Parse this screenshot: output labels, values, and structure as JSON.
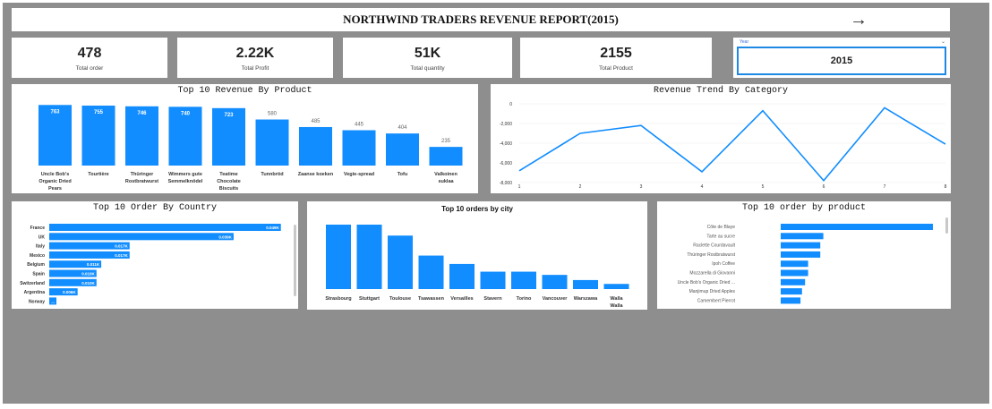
{
  "header": {
    "title": "NORTHWIND TRADERS REVENUE REPORT(2015)",
    "arrow_icon": "arrow-right-icon"
  },
  "kpis": [
    {
      "value": "478",
      "label": "Total order"
    },
    {
      "value": "2.22K",
      "label": "Total Profit"
    },
    {
      "value": "51K",
      "label": "Total quantity"
    },
    {
      "value": "2155",
      "label": "Total Product"
    }
  ],
  "slicer": {
    "label": "Year",
    "value": "2015"
  },
  "colors": {
    "accent": "#118dff",
    "background": "#8e8e8e"
  },
  "chart_data": [
    {
      "type": "bar",
      "title": "Top 10 Revenue By Product",
      "categories": [
        "Uncle Bob's Organic Dried Pears",
        "Tourtière",
        "Thüringer Rostbratwurst",
        "Wimmers gute Semmelknödel",
        "Teatime Chocolate Biscuits",
        "Tunnbröd",
        "Zaanse koeken",
        "Vegie-spread",
        "Tofu",
        "Valkoinen suklaa"
      ],
      "label_lines": [
        [
          "Uncle Bob's",
          "Organic Dried",
          "Pears"
        ],
        [
          "Tourtière"
        ],
        [
          "Thüringer",
          "Rostbratwurst"
        ],
        [
          "Wimmers gute",
          "Semmelknödel"
        ],
        [
          "Teatime",
          "Chocolate",
          "Biscuits"
        ],
        [
          "Tunnbröd"
        ],
        [
          "Zaanse koeken"
        ],
        [
          "Vegie-spread"
        ],
        [
          "Tofu"
        ],
        [
          "Valkoinen",
          "suklaa"
        ]
      ],
      "values": [
        763,
        755,
        746,
        740,
        723,
        580,
        485,
        445,
        404,
        235
      ],
      "ylim": [
        0,
        800
      ]
    },
    {
      "type": "line",
      "title": "Revenue Trend By Category",
      "x": [
        1,
        2,
        3,
        4,
        5,
        6,
        7,
        8
      ],
      "y": [
        -6800,
        -3000,
        -2200,
        -6900,
        -700,
        -7800,
        -400,
        -4100
      ],
      "ylim": [
        -8000,
        0
      ],
      "yticks": [
        "0",
        "-2,000",
        "-4,000",
        "-6,000",
        "-8,000"
      ],
      "grid": true
    },
    {
      "type": "bar",
      "orientation": "horizontal",
      "title": "Top 10 Order By Country",
      "categories": [
        "France",
        "UK",
        "Italy",
        "Mexico",
        "Belgium",
        "Spain",
        "Switzerland",
        "Argentina",
        "Norway"
      ],
      "values": [
        49,
        39,
        17,
        17,
        11,
        10,
        10,
        6,
        1
      ],
      "labels": [
        "0.049K",
        "0.039K",
        "0.017K",
        "0.017K",
        "0.011K",
        "0.010K",
        "0.010K",
        "0.006K",
        "..."
      ],
      "xlim": [
        0,
        50
      ]
    },
    {
      "type": "bar",
      "title": "Top 10 orders by city",
      "categories": [
        "Strasbourg",
        "Stuttgart",
        "Toulouse",
        "Tsawassen",
        "Versailles",
        "Stavern",
        "Torino",
        "Vancouver",
        "Warszawa",
        "Walla Walla"
      ],
      "label_lines": [
        [
          "Strasbourg"
        ],
        [
          "Stuttgart"
        ],
        [
          "Toulouse"
        ],
        [
          "Tsawassen"
        ],
        [
          "Versailles"
        ],
        [
          "Stavern"
        ],
        [
          "Torino"
        ],
        [
          "Vancouver"
        ],
        [
          "Warszawa"
        ],
        [
          "Walla",
          "Walla"
        ]
      ],
      "values": [
        100,
        100,
        83,
        52,
        39,
        27,
        27,
        22,
        14,
        8
      ],
      "ylim": [
        0,
        100
      ]
    },
    {
      "type": "bar",
      "orientation": "horizontal",
      "title": "Top 10 order by product",
      "categories": [
        "Côte de Blaye",
        "Tarte au sucre",
        "Raclette Courdavault",
        "Thüringer Rostbratwurst",
        "Ipoh Coffee",
        "Mozzarella di Giovanni",
        "Uncle Bob's Organic Dried ...",
        "Manjimup Dried Apples",
        "Camembert Pierrot"
      ],
      "values": [
        100,
        28,
        26,
        26,
        18,
        18,
        16,
        14,
        13
      ],
      "xlim": [
        0,
        100
      ]
    }
  ]
}
